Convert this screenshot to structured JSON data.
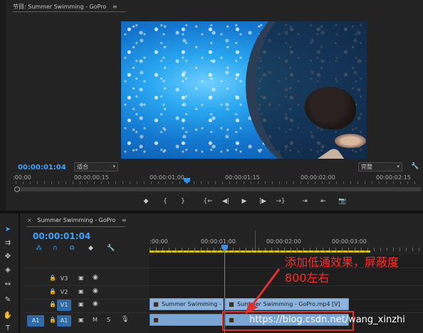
{
  "program_monitor": {
    "title": "节目: Summer Swimming - GoPro",
    "menu_glyph": "≡",
    "timecode": "00:00:01:04",
    "fit": "适合",
    "resolution": "完整",
    "ruler_labels": [
      ":00:00",
      "00:00:00:15",
      "00:00:01:00",
      "00:00:01:15",
      "00:00:02:00",
      "00:00:02:15"
    ],
    "transport": [
      "◆",
      "{",
      "}",
      "{←",
      "◀|",
      "▶",
      "|▶",
      "→}",
      "⇥",
      "⇤",
      "📷"
    ]
  },
  "timeline": {
    "sequence_tab": "Summer Swimming - GoPro",
    "close_glyph": "×",
    "menu_glyph": "≡",
    "timecode": "00:00:01:04",
    "ruler_labels": [
      ":00:00",
      "00:00:01:00",
      "00:00:02:00",
      "00:00:03:00"
    ],
    "tracks": {
      "v3": "V3",
      "v2": "V2",
      "v1": "V1",
      "a1_source": "A1",
      "a1": "A1",
      "mute": "M",
      "solo": "S"
    },
    "clips": {
      "v1_left": "Summer Swimming - G",
      "v1_right": "Summer Swimming - GoPro.mp4 [V]"
    }
  },
  "annotation": {
    "text": "添加低通效果，屏蔽度800左右",
    "watermark": "https://blog.csdn.net/wang_xinzhi",
    "color": "#ff2a2a"
  },
  "colors": {
    "accent": "#3aa3ff",
    "clip": "#8cb4e0",
    "work_area": "#d4c020"
  }
}
